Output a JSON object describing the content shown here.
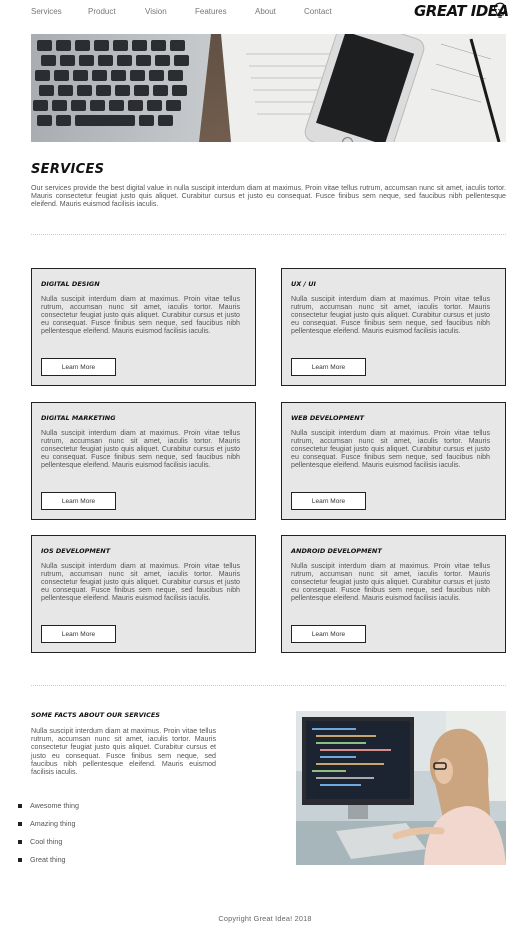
{
  "nav": {
    "items": [
      "Services",
      "Product",
      "Vision",
      "Features",
      "About",
      "Contact"
    ],
    "logo": "GREAT IDEA"
  },
  "services": {
    "title": "SERVICES",
    "text": "Our services provide the best digital value in nulla suscipit interdum diam at maximus. Proin vitae tellus rutrum, accumsan nunc sit amet, iaculis tortor. Mauris consectetur feugiat justo quis aliquet. Curabitur cursus et justo eu consequat. Fusce finibus sem neque, sed faucibus nibh pellentesque eleifend. Mauris euismod facilisis iaculis."
  },
  "cards": [
    {
      "title": "DIGITAL DESIGN",
      "text": "Nulla suscipit interdum diam at maximus. Proin vitae tellus rutrum, accumsan nunc sit amet, iaculis tortor. Mauris consectetur feugiat justo quis aliquet. Curabitur cursus et justo eu consequat. Fusce finibus sem neque, sed faucibus nibh pellentesque eleifend. Mauris euismod facilisis iaculis.",
      "button": "Learn More"
    },
    {
      "title": "UX / UI",
      "text": "Nulla suscipit interdum diam at maximus. Proin vitae tellus rutrum, accumsan nunc sit amet, iaculis tortor. Mauris consectetur feugiat justo quis aliquet. Curabitur cursus et justo eu consequat. Fusce finibus sem neque, sed faucibus nibh pellentesque eleifend. Mauris euismod facilisis iaculis.",
      "button": "Learn More"
    },
    {
      "title": "DIGITAL MARKETING",
      "text": "Nulla suscipit interdum diam at maximus. Proin vitae tellus rutrum, accumsan nunc sit amet, iaculis tortor. Mauris consectetur feugiat justo quis aliquet. Curabitur cursus et justo eu consequat. Fusce finibus sem neque, sed faucibus nibh pellentesque eleifend. Mauris euismod facilisis iaculis.",
      "button": "Learn More"
    },
    {
      "title": "WEB DEVELOPMENT",
      "text": "Nulla suscipit interdum diam at maximus. Proin vitae tellus rutrum, accumsan nunc sit amet, iaculis tortor. Mauris consectetur feugiat justo quis aliquet. Curabitur cursus et justo eu consequat. Fusce finibus sem neque, sed faucibus nibh pellentesque eleifend. Mauris euismod facilisis iaculis.",
      "button": "Learn More"
    },
    {
      "title": "IOS DEVELOPMENT",
      "text": "Nulla suscipit interdum diam at maximus. Proin vitae tellus rutrum, accumsan nunc sit amet, iaculis tortor. Mauris consectetur feugiat justo quis aliquet. Curabitur cursus et justo eu consequat. Fusce finibus sem neque, sed faucibus nibh pellentesque eleifend. Mauris euismod facilisis iaculis.",
      "button": "Learn More"
    },
    {
      "title": "ANDROID DEVELOPMENT",
      "text": "Nulla suscipit interdum diam at maximus. Proin vitae tellus rutrum, accumsan nunc sit amet, iaculis tortor. Mauris consectetur feugiat justo quis aliquet. Curabitur cursus et justo eu consequat. Fusce finibus sem neque, sed faucibus nibh pellentesque eleifend. Mauris euismod facilisis iaculis.",
      "button": "Learn More"
    }
  ],
  "facts": {
    "title": "SOME FACTS ABOUT OUR SERVICES",
    "text": "Nulla suscipit interdum diam at maximus. Proin vitae tellus rutrum, accumsan nunc sit amet, iaculis tortor. Mauris consectetur feugiat justo quis aliquet. Curabitur cursus et justo eu consequat. Fusce finibus sem neque, sed faucibus nibh pellentesque eleifend. Mauris euismod facilisis iaculis.",
    "list": [
      "Awesome thing",
      "Amazing thing",
      "Cool thing",
      "Great thing"
    ]
  },
  "footer": {
    "text": "Copyright Great Idea! 2018"
  }
}
